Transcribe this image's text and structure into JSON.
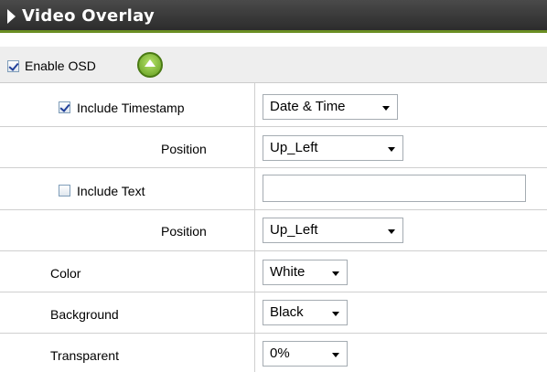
{
  "header": {
    "title": "Video Overlay"
  },
  "osd": {
    "enable_label": "Enable OSD",
    "enabled": true
  },
  "rows": {
    "timestamp": {
      "label": "Include Timestamp",
      "checked": true,
      "value": "Date & Time"
    },
    "timestamp_position": {
      "label": "Position",
      "value": "Up_Left"
    },
    "text": {
      "label": "Include Text",
      "checked": false,
      "value": ""
    },
    "text_position": {
      "label": "Position",
      "value": "Up_Left"
    },
    "color": {
      "label": "Color",
      "value": "White"
    },
    "background": {
      "label": "Background",
      "value": "Black"
    },
    "transparent": {
      "label": "Transparent",
      "value": "0%"
    }
  },
  "icons": {
    "header": "expand-arrow-icon",
    "collapse": "collapse-up-icon"
  },
  "colors": {
    "header_bg": "#333333",
    "header_accent": "#6b8e23",
    "osd_bar_bg": "#eeeeee"
  }
}
